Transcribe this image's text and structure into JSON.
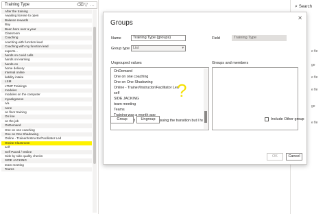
{
  "filter_pane": {
    "field_title": "Training Type",
    "header_icons": [
      "filter-clear-icon",
      "filter-icon",
      "more-options-icon"
    ],
    "items": [
      "After the training",
      "Awaiting license to open",
      "Balance rewards",
      "Bay",
      "Been here over a year",
      "Classroom",
      "Coaching",
      "coaching with function lead",
      "Coaching with my function lead",
      "experts...",
      "hands on covid calls",
      "hands on learning",
      "hands-on",
      "home delivery",
      "Internal online",
      "liability intake",
      "LSM",
      "LTMP Trainings",
      "modules",
      "modules on the computer",
      "myaskgreens",
      "n/a",
      "none",
      "on floor training",
      "On line",
      "on the job",
      "OnDemand",
      "One on one coaching",
      "One on One Shadowing",
      "Online - Trainer/Instructor/Facilitator Led",
      "Onsite Classroom",
      "self",
      "Self Paced / Online",
      "Side by side quality checks",
      "SIDE JACKING",
      "team meeting",
      "Teams"
    ],
    "highlighted_item": "Onsite Classroom"
  },
  "right_pane": {
    "search_label": "Search",
    "peek": [
      "e fie",
      "ge",
      "e fie",
      "e fie",
      "ge",
      "e fie"
    ]
  },
  "dialog": {
    "title": "Groups",
    "close_label": "✕",
    "name_label": "Name",
    "name_value": "Training Type (groups)",
    "field_label": "Field",
    "field_value": "Training Type",
    "group_type_label": "Group type",
    "group_type_value": "List",
    "ungrouped_label": "Ungrouped values",
    "groups_members_label": "Groups and members",
    "ungrouped_values": [
      "OnDemand",
      "One on one coaching",
      "One on One Shadowing",
      "Online - Trainer/Instructor/Facilitator Led",
      "self",
      "SIDE JACKING",
      "team meeting",
      "Teams",
      "Training was a month ago",
      "We have had meetings discussing the transition but I have no"
    ],
    "group_button": "Group",
    "ungroup_button": "Ungroup",
    "include_other_label": "Include Other group",
    "ok_button": "OK",
    "cancel_button": "Cancel"
  }
}
